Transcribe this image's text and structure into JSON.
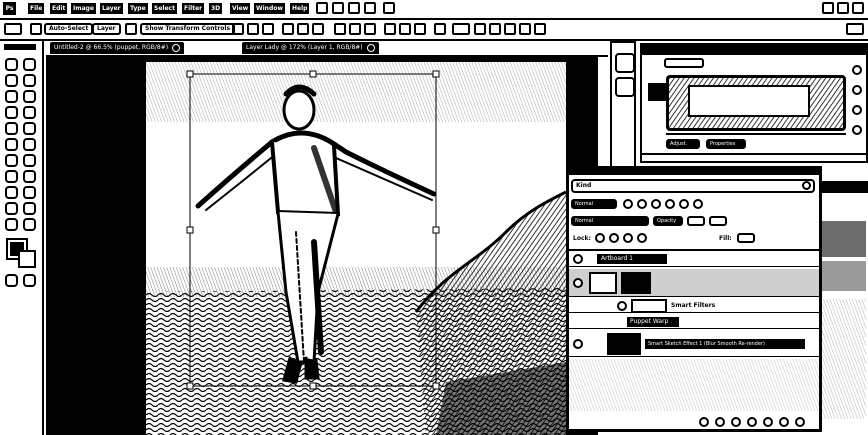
{
  "app": {
    "logo": "Ps"
  },
  "menu": [
    "File",
    "Edit",
    "Image",
    "Layer",
    "Type",
    "Select",
    "Filter",
    "3D",
    "View",
    "Window",
    "Help"
  ],
  "options_bar": {
    "auto_select_label": "Auto-Select",
    "layer_label": "Layer",
    "show_transform_label": "Show Transform Controls"
  },
  "tabs": [
    {
      "label": "Untitled-2 @ 66.5% (puppet, RGB/8#)"
    },
    {
      "label": "Layer Lady @ 172% (Layer 1, RGB/8#)"
    }
  ],
  "panels": {
    "adjustments_tab": "Adjust.",
    "properties_tab": "Properties",
    "layers_search_placeholder": "Kind",
    "layers_mode_label": "Normal",
    "layers_opacity_label": "Opacity",
    "layers_lock_label": "Lock:",
    "layers_fill_label": "Fill:",
    "layer_items": [
      {
        "name": "Artboard 1"
      },
      {
        "name": "Smart Filters"
      },
      {
        "name": "Puppet Warp"
      },
      {
        "name": "Smart Sketch Effect 1 (Blur Smooth Re-render)"
      }
    ]
  },
  "colors": {
    "ink": "#000000",
    "paper": "#ffffff",
    "swatch_dark": "#6e6e6e",
    "swatch_mid": "#9a9a9a"
  }
}
